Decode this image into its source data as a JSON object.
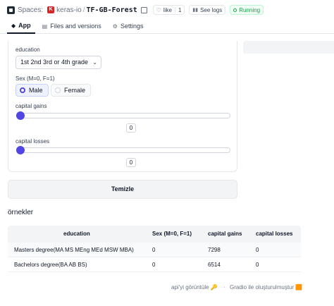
{
  "header": {
    "spaces_label": "Spaces:",
    "owner_initial": "K",
    "owner": "keras-io",
    "repo": "TF-GB-Forest",
    "like_label": "like",
    "like_count": "1",
    "logs_label": "See logs",
    "status": "Running"
  },
  "tabs": [
    {
      "label": "App",
      "icon": "app-icon"
    },
    {
      "label": "Files and versions",
      "icon": "files-icon"
    },
    {
      "label": "Settings",
      "icon": "gear-icon"
    }
  ],
  "form": {
    "education": {
      "label": "education",
      "value": "1st 2nd 3rd or 4th grade"
    },
    "sex": {
      "label": "Sex (M=0, F=1)",
      "options": [
        "Male",
        "Female"
      ],
      "selected": "Male"
    },
    "capital_gains": {
      "label": "capital gains",
      "value": "0",
      "slider_fraction": 0
    },
    "capital_losses": {
      "label": "capital losses",
      "value": "0",
      "slider_fraction": 0
    }
  },
  "clear_label": "Temizle",
  "examples": {
    "title": "örnekler",
    "columns": [
      "education",
      "Sex (M=0, F=1)",
      "capital gains",
      "capital losses"
    ],
    "rows": [
      [
        "Masters degree(MA MS MEng MEd MSW MBA)",
        "0",
        "7298",
        "0"
      ],
      [
        "Bachelors degree(BA AB BS)",
        "0",
        "6514",
        "0"
      ]
    ]
  },
  "footer": {
    "api_link": "api'yi görüntüle 🔑",
    "built_with": "Gradio ile oluşturulmuştur 🟧"
  },
  "colors": {
    "accent": "#4f46e5",
    "running": "#16a34a",
    "owner_badge": "#dc2626"
  }
}
